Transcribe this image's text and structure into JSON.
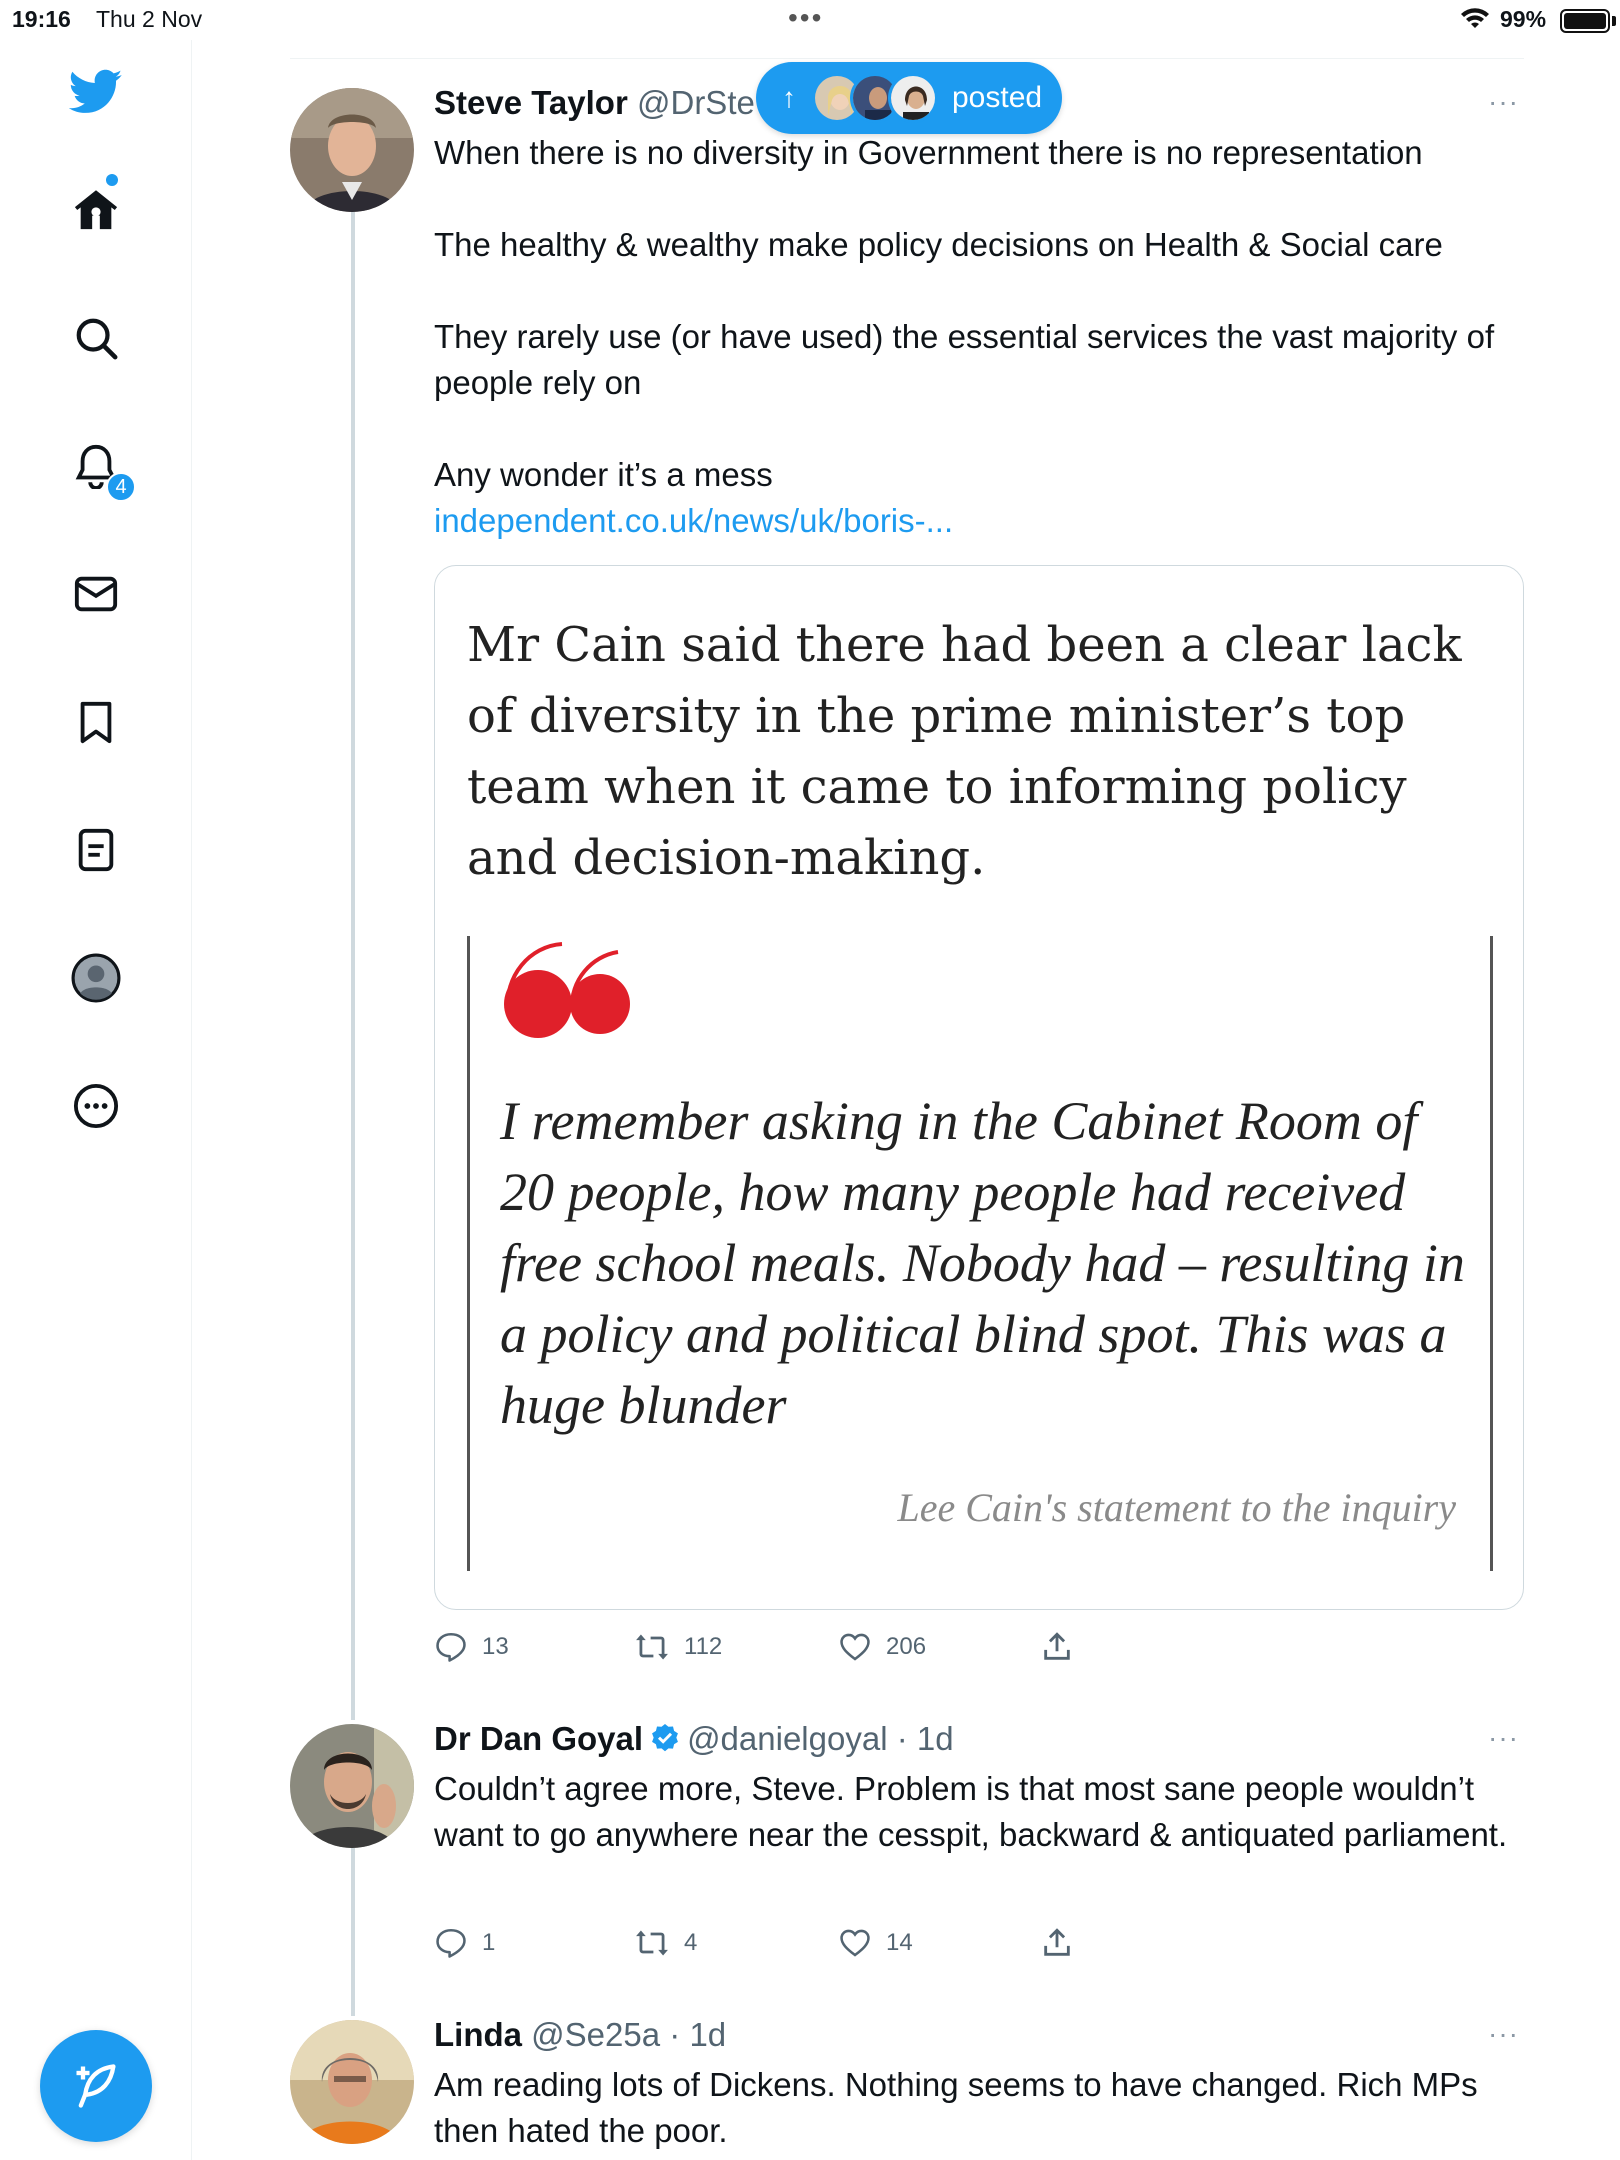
{
  "status_bar": {
    "time": "19:16",
    "date": "Thu 2 Nov",
    "battery": "99%"
  },
  "sidebar": {
    "items": [
      {
        "icon": "home-icon"
      },
      {
        "icon": "search-icon"
      },
      {
        "icon": "bell-icon",
        "badge": "4"
      },
      {
        "icon": "mail-icon"
      },
      {
        "icon": "bookmark-icon"
      },
      {
        "icon": "lists-icon"
      },
      {
        "icon": "profile-icon"
      },
      {
        "icon": "more-circle-icon"
      }
    ],
    "compose_icon": "compose-feather-icon"
  },
  "posted_pill": {
    "label": "posted",
    "arrow": "↑"
  },
  "colors": {
    "accent": "#1d9bf0",
    "text": "#0f1419",
    "secondary": "#536471",
    "quote_red": "#e0202a"
  },
  "tweets": [
    {
      "name": "Steve Taylor",
      "handle": "@DrSte",
      "more": "···",
      "text": [
        "When there is no diversity in Government there is no representation",
        "",
        "The healthy & wealthy make policy decisions on Health & Social care",
        "",
        "They rarely use (or have used) the essential services the vast majority of people rely on",
        "",
        "Any wonder it’s a mess"
      ],
      "link": "independent.co.uk/news/uk/boris-...",
      "card": {
        "lead": "Mr Cain said there had been a clear lack of diversity in the prime minister’s top team when it came to informing policy and decision-making.",
        "quote": "I remember asking in the Cabinet Room of 20 people, how many people had received free school meals. Nobody had – resulting in a policy and political blind spot. This was a huge blunder",
        "attribution": "Lee Cain's statement to the inquiry"
      },
      "replies": "13",
      "retweets": "112",
      "likes": "206"
    },
    {
      "name": "Dr Dan Goyal",
      "handle": "@danielgoyal",
      "time": "· 1d",
      "more": "···",
      "text": "Couldn’t agree more, Steve. Problem is that most sane people wouldn’t want to go anywhere near the cesspit, backward & antiquated parliament.",
      "replies": "1",
      "retweets": "4",
      "likes": "14"
    },
    {
      "name": "Linda",
      "handle": "@Se25a",
      "time": "· 1d",
      "more": "···",
      "text": "Am reading lots of Dickens. Nothing seems to have changed. Rich MPs then hated the poor."
    }
  ]
}
